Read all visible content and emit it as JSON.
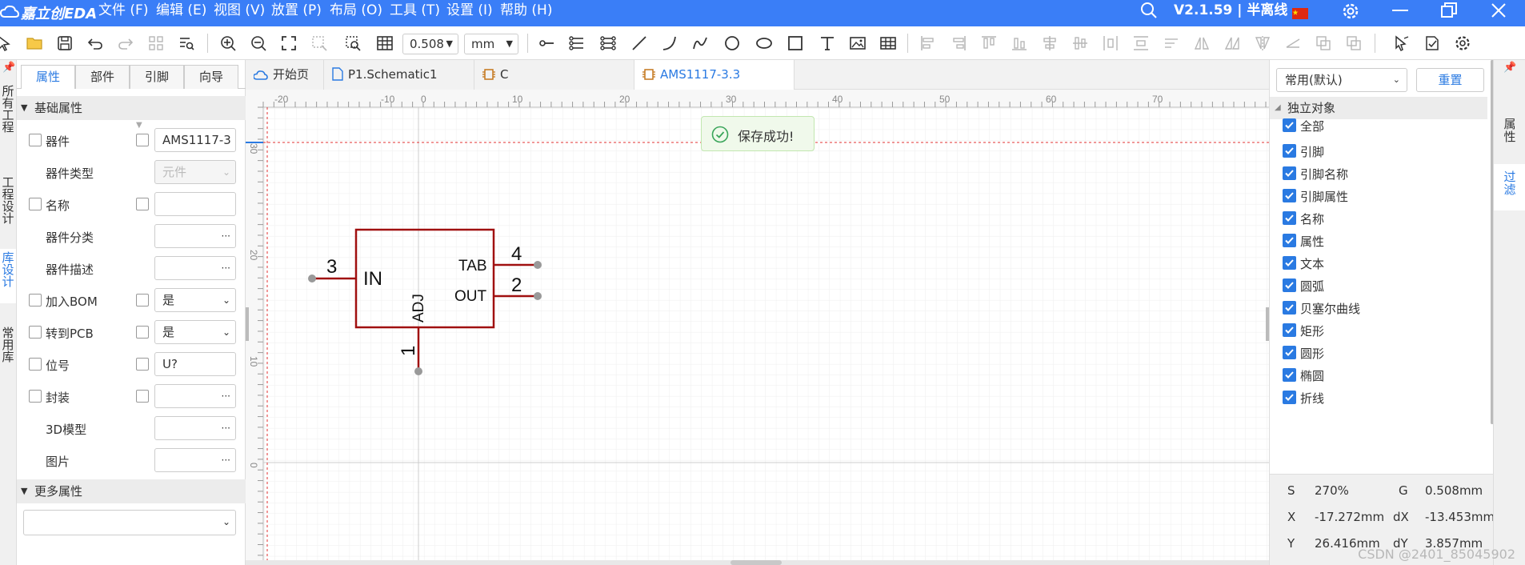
{
  "app": {
    "logo_text": "嘉立创EDA",
    "menu": [
      "文件 (F)",
      "编辑 (E)",
      "视图 (V)",
      "放置 (P)",
      "布局 (O)",
      "工具 (T)",
      "设置 (I)",
      "帮助 (H)"
    ],
    "version": "V2.1.59 | 半离线"
  },
  "toolbar": {
    "grid_value": "0.508",
    "unit_value": "mm"
  },
  "left_strip": {
    "tabs": [
      "所有工程",
      "工程设计",
      "库设计",
      "常用库"
    ]
  },
  "left_panel": {
    "tabs": [
      "属性",
      "部件",
      "引脚",
      "向导"
    ],
    "section_basic": "基础属性",
    "section_more": "更多属性",
    "rows": [
      {
        "label": "器件",
        "value": "AMS1117-3"
      },
      {
        "label": "器件类型",
        "value": "元件"
      },
      {
        "label": "名称",
        "value": ""
      },
      {
        "label": "器件分类",
        "value": ""
      },
      {
        "label": "器件描述",
        "value": ""
      },
      {
        "label": "加入BOM",
        "value": "是"
      },
      {
        "label": "转到PCB",
        "value": "是"
      },
      {
        "label": "位号",
        "value": "U?"
      },
      {
        "label": "封装",
        "value": ""
      },
      {
        "label": "3D模型",
        "value": ""
      },
      {
        "label": "图片",
        "value": ""
      }
    ],
    "more_select": ""
  },
  "doc_tabs": [
    "开始页",
    "P1.Schematic1",
    "C",
    "AMS1117-3.3"
  ],
  "ruler": {
    "h_labels": [
      "-20",
      "-10",
      "0",
      "10",
      "20",
      "30",
      "40",
      "50",
      "60",
      "70"
    ],
    "v_labels": [
      "30",
      "20",
      "10",
      "0"
    ]
  },
  "symbol": {
    "pin_in_name": "IN",
    "pin_in_number": "3",
    "pin_tab_name": "TAB",
    "pin_tab_number": "4",
    "pin_out_name": "OUT",
    "pin_out_number": "2",
    "pin_adj_name": "ADJ",
    "pin_adj_number": "1"
  },
  "toast": {
    "message": "保存成功!"
  },
  "right_panel": {
    "select_value": "常用(默认)",
    "reset_label": "重置",
    "group_label": "独立对象",
    "filters": [
      "全部",
      "引脚",
      "引脚名称",
      "引脚属性",
      "名称",
      "属性",
      "文本",
      "圆弧",
      "贝塞尔曲线",
      "矩形",
      "圆形",
      "椭圆",
      "折线"
    ]
  },
  "status": {
    "s_label": "S",
    "s_value": "270%",
    "g_label": "G",
    "g_value": "0.508mm",
    "x_label": "X",
    "x_value": "-17.272mm",
    "dx_label": "dX",
    "dx_value": "-13.453mm",
    "y_label": "Y",
    "y_value": "26.416mm",
    "dy_label": "dY",
    "dy_value": "3.857mm"
  },
  "right_strip": {
    "tabs": [
      "属性",
      "过滤"
    ]
  },
  "watermark": "CSDN @2401_85045902",
  "colors": {
    "title_bar": "#3a7ef7",
    "accent": "#2a7ae2",
    "symbol_outline": "#a01010",
    "pin_end": "#999999",
    "guide_line": "#e03030"
  }
}
